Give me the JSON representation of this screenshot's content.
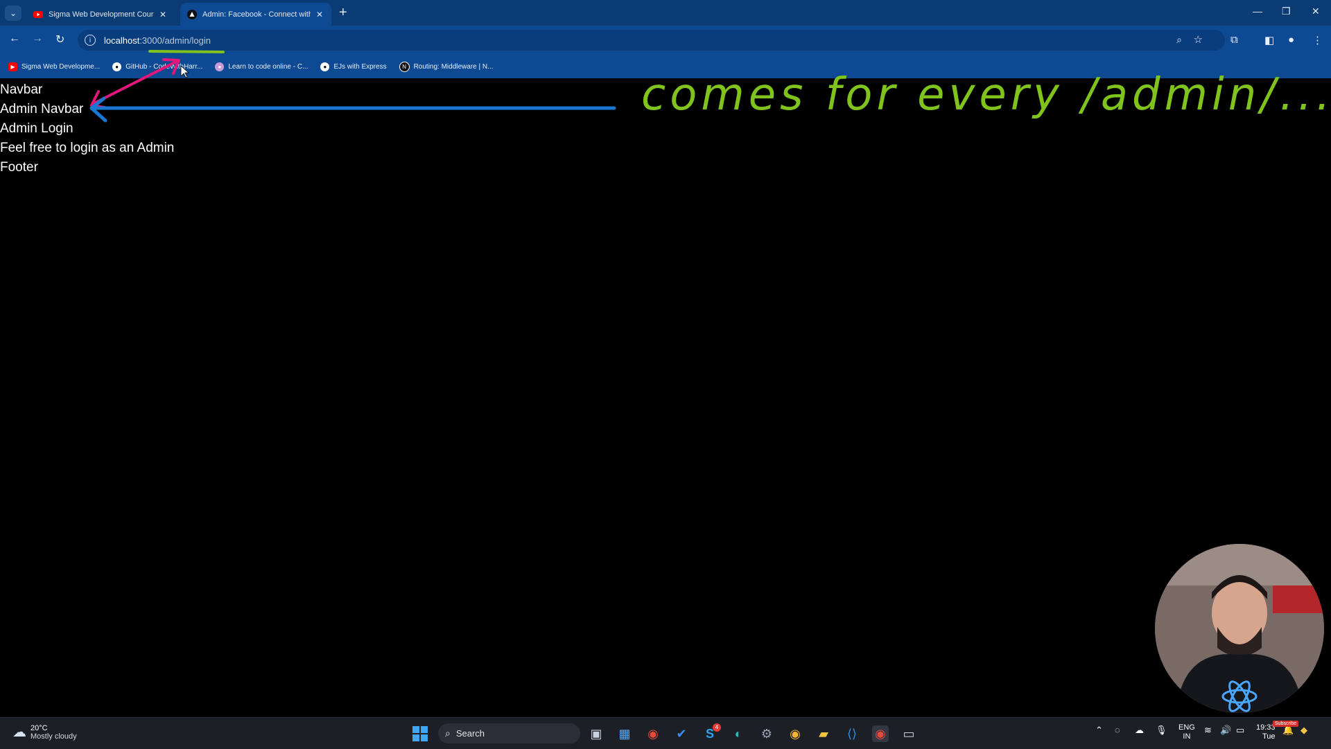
{
  "browser": {
    "tabs": [
      {
        "title": "Sigma Web Development Course - W",
        "active": false
      },
      {
        "title": "Admin: Facebook - Connect with frien",
        "active": true
      }
    ],
    "url_host": "localhost",
    "url_rest": ":3000/admin/login",
    "bookmarks": [
      {
        "label": "Sigma Web Developme..."
      },
      {
        "label": "GitHub - CodeWithHarr..."
      },
      {
        "label": "Learn to code online - C..."
      },
      {
        "label": "EJs with Express"
      },
      {
        "label": "Routing: Middleware | N..."
      }
    ]
  },
  "page": {
    "lines": [
      "Navbar",
      "Admin Navbar",
      "Admin Login",
      "Feel free to login as an Admin",
      "Footer"
    ]
  },
  "annotation": {
    "text": "comes for every /admin/...",
    "color": "#7fc31c"
  },
  "taskbar": {
    "weather_temp": "20°C",
    "weather_condition": "Mostly cloudy",
    "search_placeholder": "Search",
    "language": "ENG",
    "region": "IN",
    "time": "19:33",
    "day": "Tue",
    "badge_count": "4",
    "subscribe_label": "Subscribe"
  },
  "colors": {
    "chrome_blue": "#0e4a94",
    "tabstrip_blue": "#0b3b73",
    "annotation_green": "#7fc31c",
    "arrow_pink": "#e0187a",
    "arrow_blue": "#1976d2"
  }
}
